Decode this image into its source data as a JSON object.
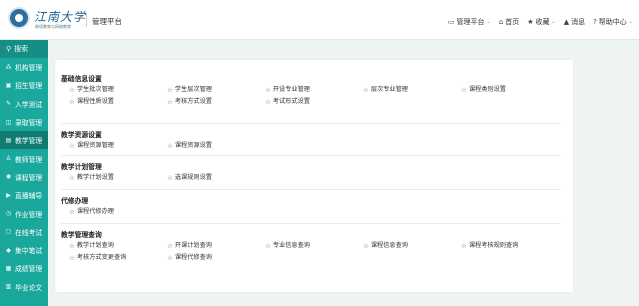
{
  "header": {
    "logo_text": "江南大学",
    "logo_sub": "继续教育与网络教育",
    "platform": "管理平台",
    "nav": [
      {
        "label": "管理平台",
        "icon": "monitor-icon",
        "glyph": "▭",
        "caret": "⌄"
      },
      {
        "label": "首页",
        "icon": "home-icon",
        "glyph": "⌂",
        "caret": ""
      },
      {
        "label": "收藏",
        "icon": "star-icon",
        "glyph": "★",
        "caret": "⌄"
      },
      {
        "label": "消息",
        "icon": "bell-icon",
        "glyph": "▲",
        "caret": ""
      },
      {
        "label": "帮助中心",
        "icon": "help-icon",
        "glyph": "?",
        "caret": "⌄"
      }
    ]
  },
  "sidebar": {
    "search_label": "搜索",
    "items": [
      {
        "label": "机构管理",
        "glyph": "⁂"
      },
      {
        "label": "招生管理",
        "glyph": "▣"
      },
      {
        "label": "入学测试",
        "glyph": "✎"
      },
      {
        "label": "录取管理",
        "glyph": "◫"
      },
      {
        "label": "教学管理",
        "glyph": "▤",
        "active": true
      },
      {
        "label": "教师管理",
        "glyph": "♙"
      },
      {
        "label": "课程管理",
        "glyph": "◉"
      },
      {
        "label": "直播辅导",
        "glyph": "▶"
      },
      {
        "label": "作业管理",
        "glyph": "◷"
      },
      {
        "label": "在线考试",
        "glyph": "▢"
      },
      {
        "label": "集中笔试",
        "glyph": "◆"
      },
      {
        "label": "成绩管理",
        "glyph": "▦"
      },
      {
        "label": "毕业论文",
        "glyph": "▥"
      }
    ]
  },
  "sections": [
    {
      "title": "基础信息设置",
      "links": [
        "学生批次管理",
        "学生层次管理",
        "开设专业管理",
        "层次专业管理",
        "课程类别设置",
        "课程性质设置",
        "考核方式设置",
        "考试形式设置"
      ]
    },
    {
      "title": "教学资源设置",
      "links": [
        "课程资源管理",
        "课程资源设置"
      ]
    },
    {
      "title": "教学计划管理",
      "links": [
        "教学计划设置",
        "选课规则设置"
      ]
    },
    {
      "title": "代修办理",
      "links": [
        "课程代修办理"
      ]
    },
    {
      "title": "教学管理查询",
      "links": [
        "教学计划查询",
        "开课计划查询",
        "专业信息查询",
        "课程信息查询",
        "课程考核规则查询",
        "考核方式变更查询",
        "课程代修查询"
      ]
    }
  ],
  "colors": {
    "sidebar": "#1aa89c",
    "sidebar_active": "#0f7c72",
    "page_bg": "#eef3f4"
  }
}
